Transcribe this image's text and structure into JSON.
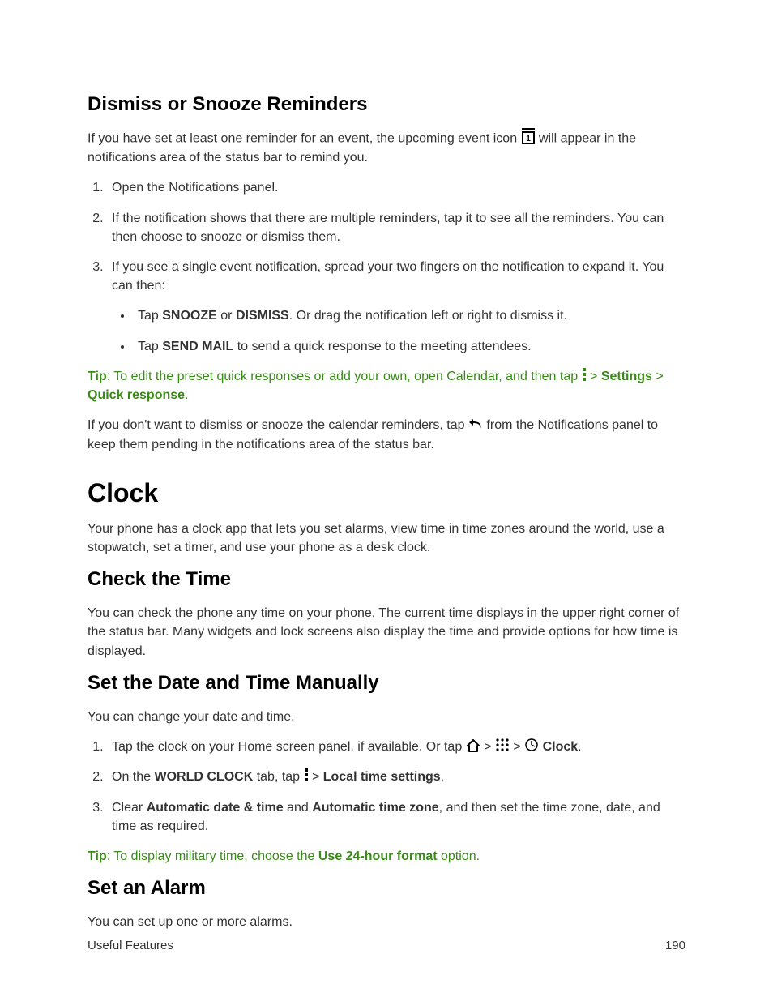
{
  "h_dismiss": "Dismiss or Snooze Reminders",
  "p_dismiss_intro_a": "If you have set at least one reminder for an event, the upcoming event icon ",
  "p_dismiss_intro_b": " will appear in the notifications area of the status bar to remind you.",
  "ol1": {
    "i1": "Open the Notifications panel.",
    "i2": "If the notification shows that there are multiple reminders, tap it to see all the reminders. You can then choose to snooze or dismiss them.",
    "i3": "If you see a single event notification, spread your two fingers on the notification to expand it. You can then:",
    "i3_b1_a": "Tap ",
    "i3_b1_snooze": "SNOOZE",
    "i3_b1_or": " or ",
    "i3_b1_dismiss": "DISMISS",
    "i3_b1_b": ". Or drag the notification left or right to dismiss it.",
    "i3_b2_a": "Tap ",
    "i3_b2_send": "SEND MAIL",
    "i3_b2_b": " to send a quick response to the meeting attendees."
  },
  "tip1": {
    "label": "Tip",
    "a": ": To edit the preset quick responses or add your own, open Calendar, and then tap ",
    "gt1": " > ",
    "settings": "Settings",
    "gt2": " > ",
    "quick": "Quick response",
    "dot": "."
  },
  "p_back_a": "If you don't want to dismiss or snooze the calendar reminders, tap ",
  "p_back_b": " from the Notifications panel to keep them pending in the notifications area of the status bar.",
  "h_clock": "Clock",
  "p_clock_intro": "Your phone has a clock app that lets you set alarms, view time in time zones around the world, use a stopwatch, set a timer, and use your phone as a desk clock.",
  "h_check": "Check the Time",
  "p_check": "You can check the phone any time on your phone. The current time displays in the upper right corner of the status bar. Many widgets and lock screens also display the time and provide options for how time is displayed.",
  "h_setdt": "Set the Date and Time Manually",
  "p_setdt": "You can change your date and time.",
  "ol2": {
    "i1_a": "Tap the clock on your Home screen panel, if available. Or tap ",
    "i1_gt1": " > ",
    "i1_gt2": " > ",
    "i1_clock": "Clock",
    "i1_dot": ".",
    "i2_a": "On the ",
    "i2_wc": "WORLD CLOCK",
    "i2_b": " tab, tap ",
    "i2_gt": " > ",
    "i2_lts": "Local time settings",
    "i2_dot": ".",
    "i3_a": "Clear ",
    "i3_adt": "Automatic date & time",
    "i3_and": " and ",
    "i3_atz": "Automatic time zone",
    "i3_b": ", and then set the time zone, date, and time as required."
  },
  "tip2": {
    "label": "Tip",
    "a": ": To display military time, choose the ",
    "fmt": "Use 24-hour format",
    "b": " option."
  },
  "h_alarm": "Set an Alarm",
  "p_alarm": "You can set up one or more alarms.",
  "footer_left": "Useful Features",
  "footer_right": "190"
}
